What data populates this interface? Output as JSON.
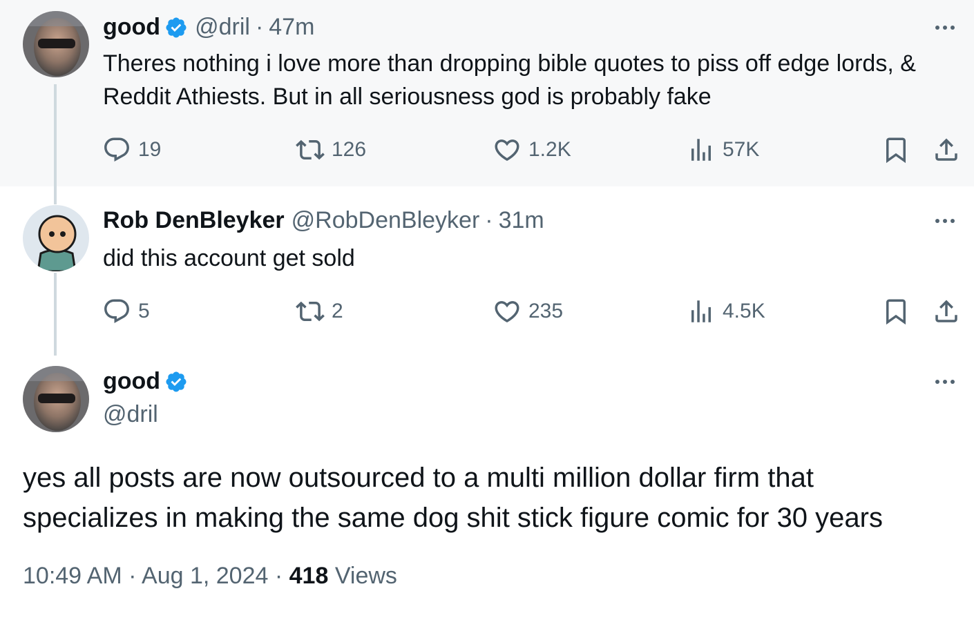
{
  "tweets": [
    {
      "name": "good",
      "handle": "@dril",
      "separator": "·",
      "time": "47m",
      "verified": true,
      "text": "Theres nothing i love more than dropping bible quotes to piss off edge lords, & Reddit Athiests. But in all seriousness god is probably fake",
      "stats": {
        "replies": "19",
        "reposts": "126",
        "likes": "1.2K",
        "views": "57K"
      }
    },
    {
      "name": "Rob DenBleyker",
      "handle": "@RobDenBleyker",
      "separator": "·",
      "time": "31m",
      "verified": false,
      "text": "did this account get sold",
      "stats": {
        "replies": "5",
        "reposts": "2",
        "likes": "235",
        "views": "4.5K"
      }
    }
  ],
  "main_tweet": {
    "name": "good",
    "handle": "@dril",
    "verified": true,
    "text": "yes all posts are now outsourced to a multi million dollar firm that specializes in making the same dog shit stick figure comic for 30 years",
    "time": "10:49 AM",
    "date": "Aug 1, 2024",
    "separator": "·",
    "views_count": "418",
    "views_label": "Views"
  },
  "icons": {
    "reply": "reply-icon",
    "repost": "repost-icon",
    "like": "heart-icon",
    "views": "analytics-icon",
    "bookmark": "bookmark-icon",
    "share": "share-icon",
    "verified": "verified-badge-icon",
    "more": "more-icon"
  },
  "colors": {
    "verified": "#1d9bf0",
    "muted": "#536471",
    "text": "#0f1419",
    "thread_line": "#cfd9de",
    "highlight_bg": "#f7f8f9"
  }
}
